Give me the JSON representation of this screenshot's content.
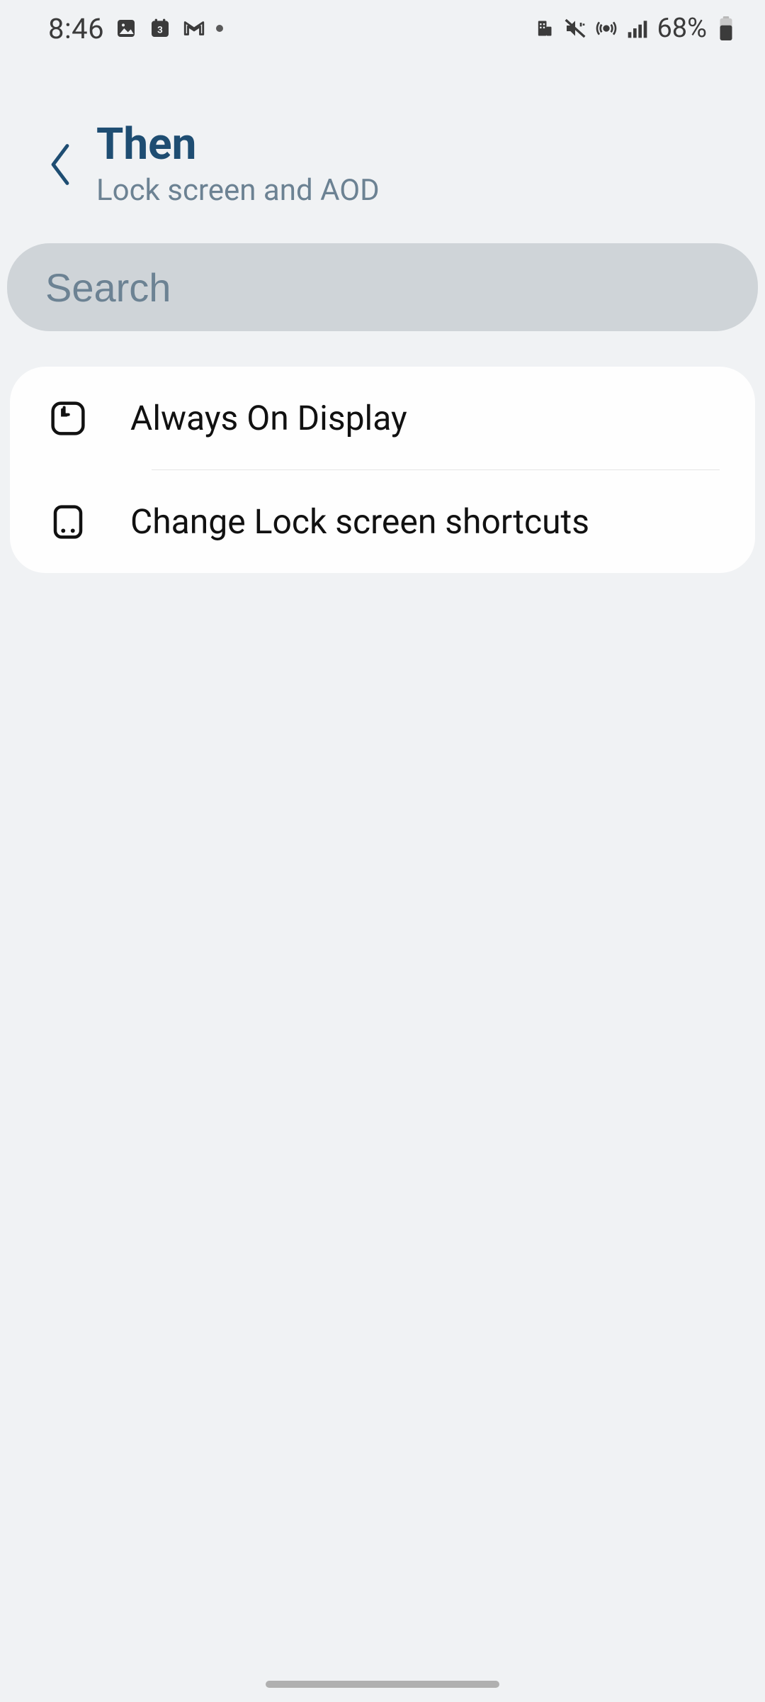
{
  "status": {
    "time": "8:46",
    "battery_text": "68%"
  },
  "header": {
    "title": "Then",
    "subtitle": "Lock screen and AOD"
  },
  "search": {
    "placeholder": "Search"
  },
  "items": [
    {
      "label": "Always On Display"
    },
    {
      "label": "Change Lock screen shortcuts"
    }
  ]
}
